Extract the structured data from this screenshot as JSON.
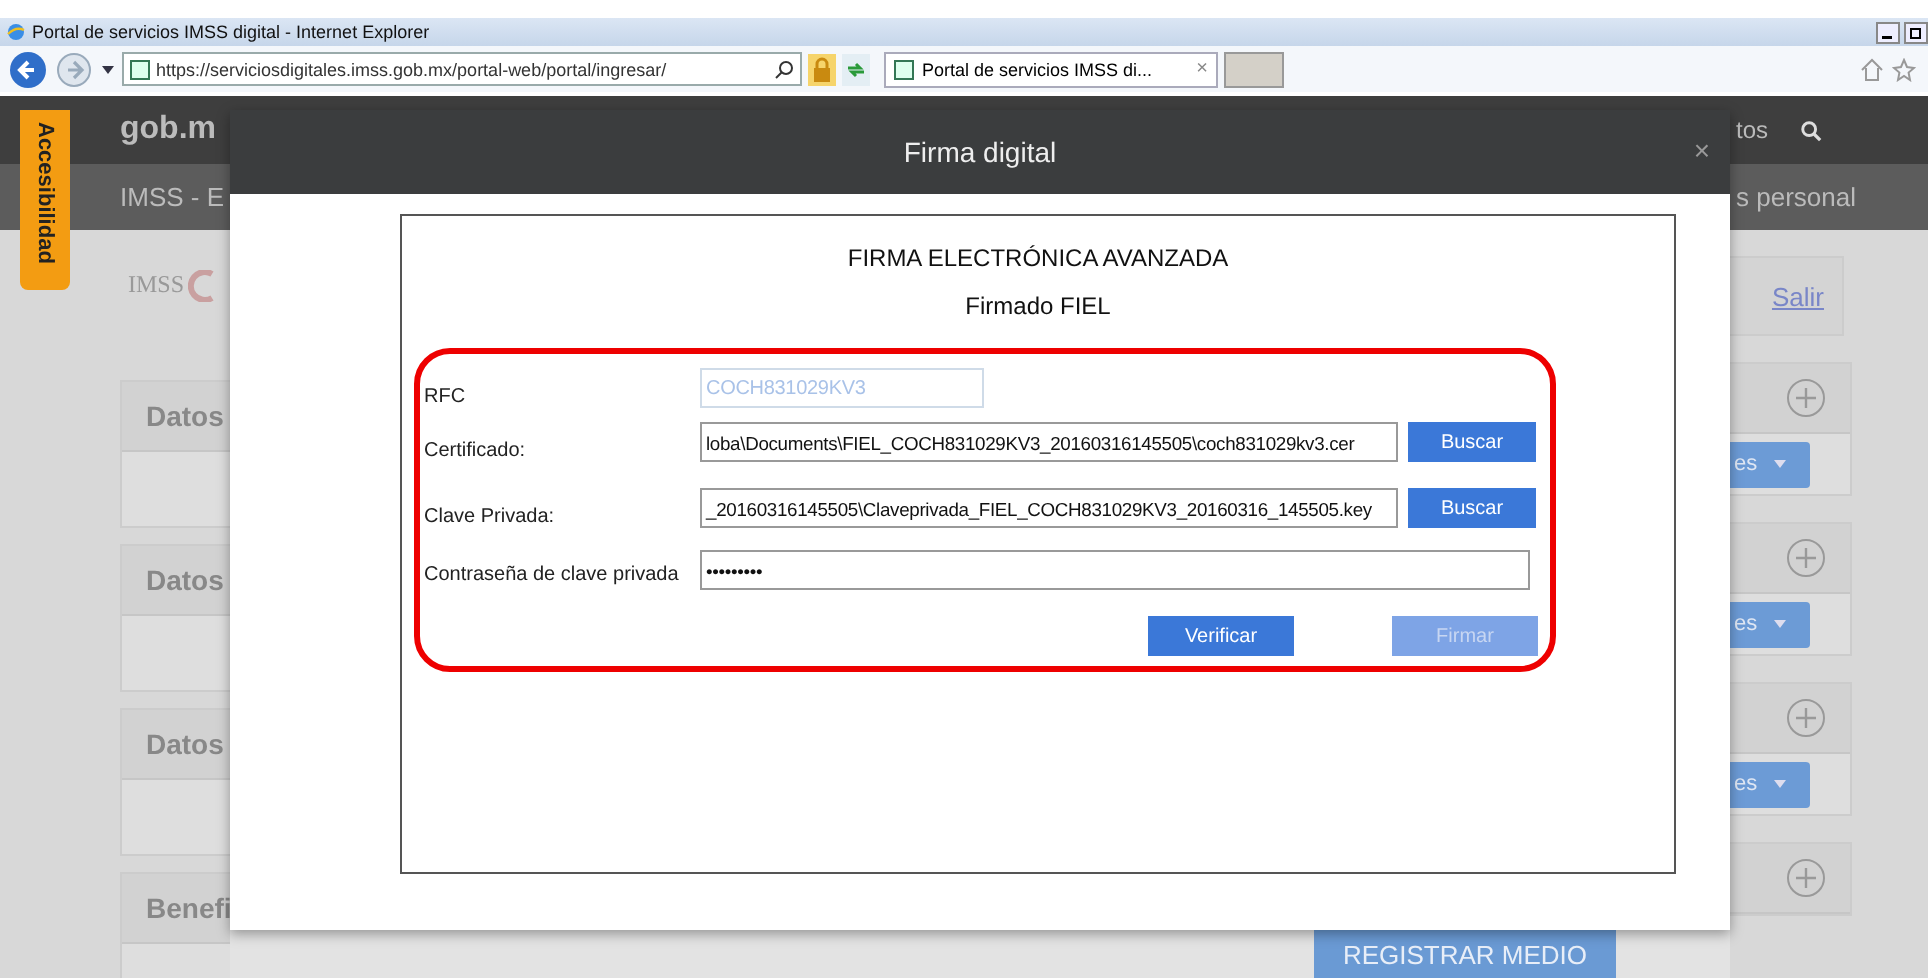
{
  "browser": {
    "title": "Portal de servicios IMSS digital - Internet Explorer",
    "url": "https://serviciosdigitales.imss.gob.mx/portal-web/portal/ingresar/",
    "tab": {
      "label": "Portal de servicios IMSS di...",
      "close": "×"
    }
  },
  "accessibility_tab": "Accesibilidad",
  "header": {
    "logo": "gob.m",
    "nav_text": "tos",
    "subtitle": "IMSS - E",
    "subtitle_right": "s personal"
  },
  "brand_logo": "IMSS",
  "left_cards": [
    {
      "title": "Datos"
    },
    {
      "title": "Datos"
    },
    {
      "title": "Datos"
    },
    {
      "title": "Benefi"
    }
  ],
  "right_panel": {
    "logout_link": "Salir",
    "cards": [
      {
        "kind": "button",
        "button": "es"
      },
      {
        "kind": "button",
        "button": "es"
      },
      {
        "kind": "button",
        "button": "es"
      },
      {
        "kind": "plus"
      }
    ]
  },
  "register_button": "REGISTRAR MEDIO",
  "dialog": {
    "title": "Firma digital",
    "close": "×",
    "heading": "FIRMA ELECTRÓNICA AVANZADA",
    "subheading": "Firmado FIEL",
    "fields": [
      {
        "label": "RFC",
        "value": "COCH831029KV3",
        "disabled": true
      },
      {
        "label": "Certificado:",
        "value": "loba\\Documents\\FIEL_COCH831029KV3_20160316145505\\coch831029kv3.cer",
        "disabled": false,
        "button": "Buscar"
      },
      {
        "label": "Clave Privada:",
        "value": "_20160316145505\\Claveprivada_FIEL_COCH831029KV3_20160316_145505.key",
        "disabled": false,
        "button": "Buscar"
      },
      {
        "label": "Contraseña de clave privada",
        "value": "•••••••••",
        "disabled": false
      }
    ],
    "actions": [
      {
        "label": "Verificar",
        "disabled": false
      },
      {
        "label": "Firmar",
        "disabled": true
      }
    ]
  }
}
